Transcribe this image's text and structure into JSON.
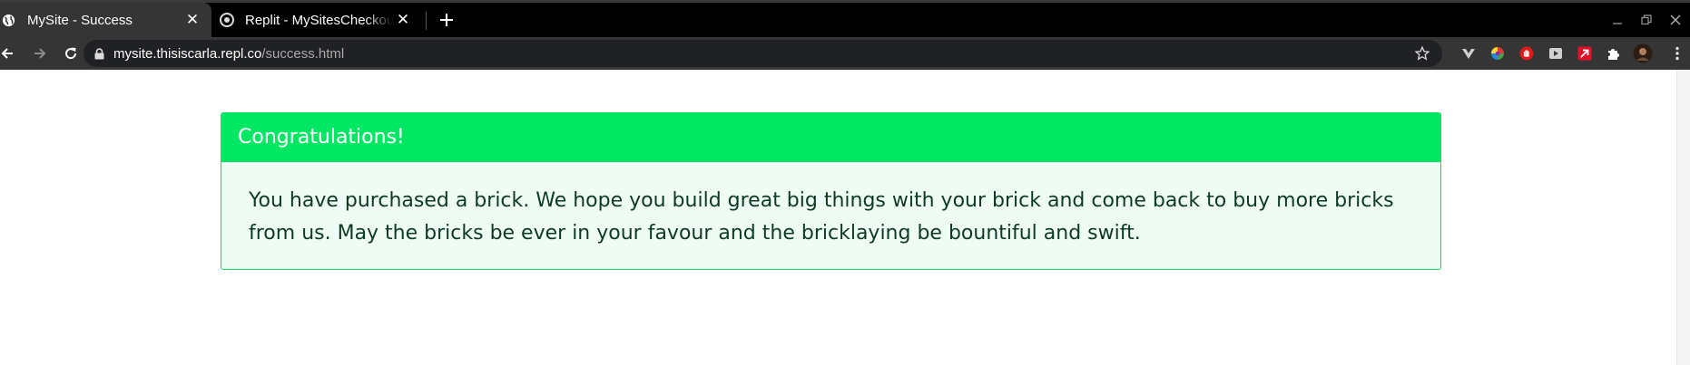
{
  "browser": {
    "tabs": [
      {
        "title": "MySite - Success",
        "active": true,
        "favicon": "globe-icon"
      },
      {
        "title": "Replit - MySitesCheckoutV",
        "active": false,
        "favicon": "replit-icon"
      }
    ],
    "address_bar": {
      "host": "mysite.thisiscarla.repl.co",
      "path": "/success.html"
    },
    "extensions": [
      "v-shape-extension-icon",
      "color-wheel-extension-icon",
      "red-hand-extension-icon",
      "video-extension-icon",
      "red-arrow-extension-icon",
      "puzzle-extensions-icon",
      "profile-avatar"
    ]
  },
  "page": {
    "alert": {
      "heading": "Congratulations!",
      "message": "You have purchased a brick. We hope you build great big things with your brick and come back to buy more bricks from us. May the bricks be ever in your favour and the bricklaying be bountiful and swift.",
      "header_color": "#00e764",
      "body_color": "#effcf5",
      "text_color": "#0d3a22"
    }
  }
}
